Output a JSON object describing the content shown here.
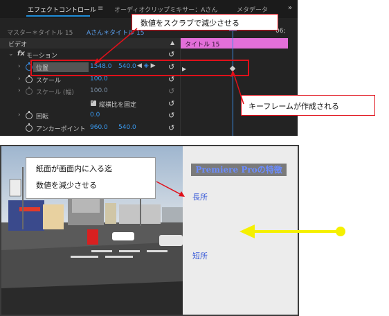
{
  "tabs": {
    "effect_controls": "エフェクトコントロール",
    "menu_icon": "≡",
    "audio_mixer": "オーディオクリップミキサー：Aさん",
    "metadata": "メタデータ",
    "more": "»"
  },
  "sequence": {
    "master": "マスター＊タイトル 15",
    "clip": "Aさん＊タイトル 15",
    "time": "06;"
  },
  "section": {
    "video": "ビデオ",
    "collapse": "▲"
  },
  "timeline": {
    "clip_name": "タイトル 15"
  },
  "properties": {
    "motion": "モーション",
    "position": "位置",
    "position_x": "1548.0",
    "position_y": "540.0",
    "scale": "スケール",
    "scale_value": "100.0",
    "scale_width": "スケール (幅)",
    "scale_width_value": "100.0",
    "uniform_scale": "縦横比を固定",
    "rotation": "回転",
    "rotation_value": "0.0",
    "anchor": "アンカーポイント",
    "anchor_x": "960.0",
    "anchor_y": "540.0"
  },
  "annotations": {
    "scrub_note": "数値をスクラブで減少させる",
    "keyframe_note": "キーフレームが作成される",
    "paper_line1": "紙面が画面内に入る迄",
    "paper_line2": "数値を減少させる"
  },
  "sidebar": {
    "title": "Premiere Proの特徴",
    "item1": "長所",
    "item2": "短所"
  },
  "colors": {
    "annotation_red": "#e0101a",
    "arrow_yellow": "#f5f000",
    "clip_pink": "#e36fd9",
    "value_blue": "#3a9af0"
  }
}
